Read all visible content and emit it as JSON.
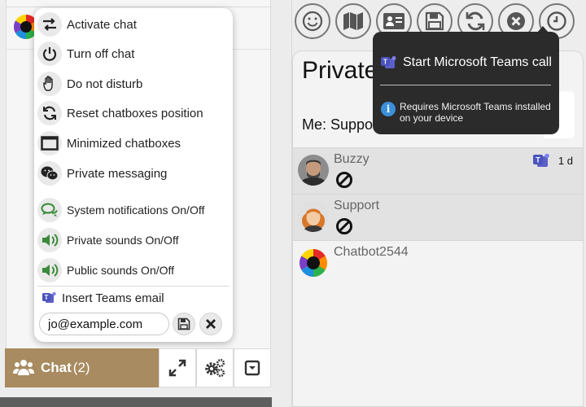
{
  "menu": {
    "items": [
      {
        "label": "Activate chat",
        "icon": "swap-arrows-icon"
      },
      {
        "label": "Turn off chat",
        "icon": "power-icon"
      },
      {
        "label": "Do not disturb",
        "icon": "hand-icon"
      },
      {
        "label": "Reset chatboxes position",
        "icon": "refresh-icon"
      },
      {
        "label": "Minimized chatboxes",
        "icon": "window-icon"
      },
      {
        "label": "Private messaging",
        "icon": "wechat-icon"
      },
      {
        "label": "System notifications On/Off",
        "icon": "comments-icon"
      },
      {
        "label": "Private sounds On/Off",
        "icon": "speaker-icon"
      },
      {
        "label": "Public sounds On/Off",
        "icon": "speaker-icon"
      }
    ],
    "teams_label": "Insert Teams email",
    "teams_email": "jo@example.com"
  },
  "bottom_bar": {
    "chat_label": "Chat",
    "chat_count": "(2)"
  },
  "right": {
    "title": "Private",
    "me_line": "Me: Suppo",
    "tooltip_title": "Start Microsoft Teams call",
    "tooltip_note": "Requires Microsoft Teams installed on your device",
    "contacts": [
      {
        "name": "Buzzy",
        "time": "1 d",
        "status": "blocked-icon"
      },
      {
        "name": "Support",
        "status": "blocked-icon"
      },
      {
        "name": "Chatbot2544"
      }
    ]
  },
  "colors": {
    "chat_tab": "#a88b60",
    "tooltip_bg": "#2b2b2b",
    "teams_purple": "#5b5fc7",
    "icon_green": "#3a8a3a"
  }
}
